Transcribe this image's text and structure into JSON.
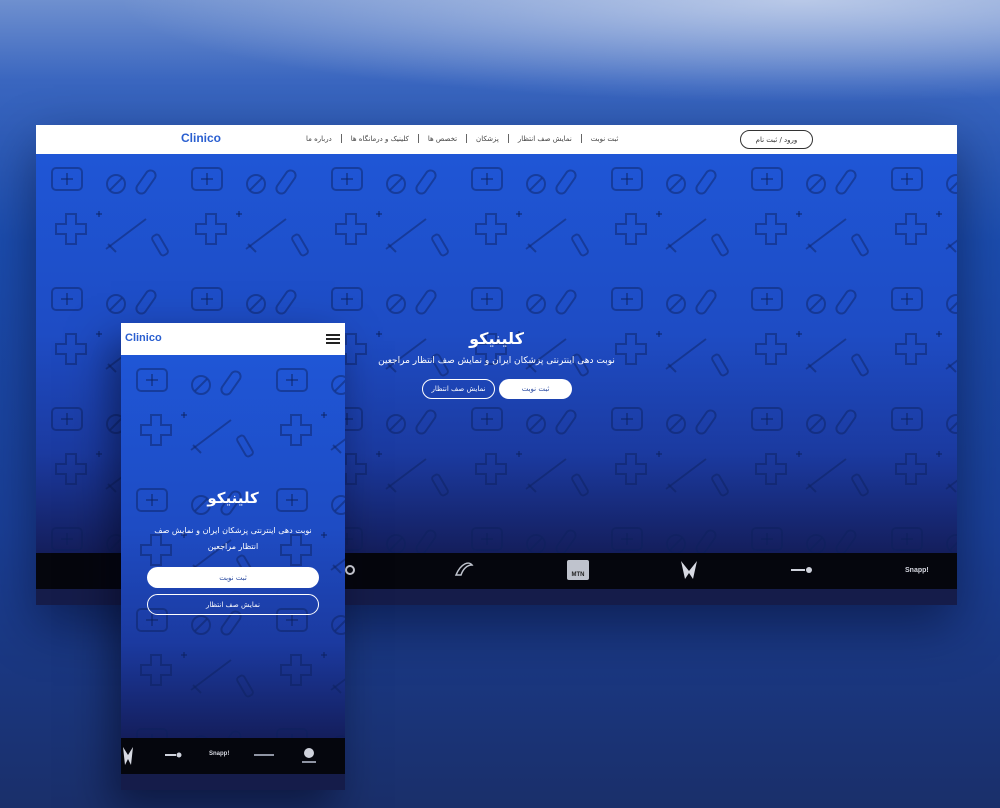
{
  "desktop": {
    "brand": "Clinico",
    "nav_items": [
      "ثبت نوبت",
      "نمایش صف انتظار",
      "پزشکان",
      "تخصص ها",
      "کلینیک و درمانگاه ها",
      "درباره ما"
    ],
    "login_label": "ورود / ثبت نام",
    "hero_title": "کلینیکو",
    "hero_subtitle": "نوبت دهی اینترنتی پزشکان ایران و نمایش صف انتظار مراجعین",
    "primary_button": "ثبت نوبت",
    "secondary_button": "نمایش صف انتظار",
    "partner_logos": [
      "snapp-logo",
      "digikala-logo",
      "university-logo",
      "mtn-irancell-logo",
      "airline-logo",
      "co-logo"
    ],
    "partner_text": {
      "snapp": "Snapp!",
      "mtn": "MTN"
    }
  },
  "mobile": {
    "brand": "Clinico",
    "menu_icon": "hamburger-icon",
    "hero_title": "کلینیکو",
    "hero_subtitle": "نوبت دهی اینترنتی پزشکان ایران و نمایش صف انتظار مراجعین",
    "primary_button": "ثبت نوبت",
    "secondary_button": "نمایش صف انتظار",
    "partner_logos": [
      "university-logo",
      "digikala-logo",
      "snapp-logo",
      "partner-logo",
      "emblem-logo"
    ],
    "partner_text": {
      "snapp": "Snapp!"
    }
  },
  "colors": {
    "brand_blue": "#2a5fd0",
    "hero_top": "#1f56d6",
    "hero_bottom": "#141e5c",
    "logo_strip": "#05060d"
  }
}
